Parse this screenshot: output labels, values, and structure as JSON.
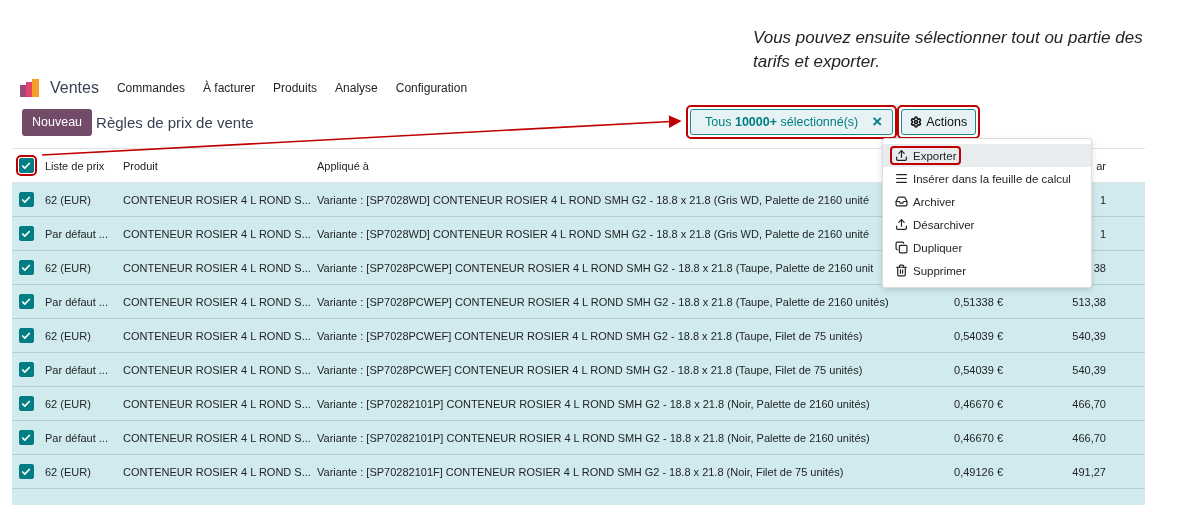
{
  "annotation": {
    "text": "Vous pouvez ensuite sélectionner tout ou partie des tarifs et exporter."
  },
  "nav": {
    "app": "Ventes",
    "menus": [
      "Commandes",
      "À facturer",
      "Produits",
      "Analyse",
      "Configuration"
    ]
  },
  "control_bar": {
    "new_button": "Nouveau",
    "title": "Règles de prix de vente"
  },
  "selection": {
    "text": "Tous **10000+** sélectionné(s)",
    "close": "×",
    "highlighted": true
  },
  "actions": {
    "label": "Actions",
    "highlighted": true,
    "menu": [
      {
        "kind": "export",
        "label": "Exporter",
        "selected": true,
        "highlighted": true
      },
      {
        "kind": "spreadsheet",
        "label": "Insérer dans la feuille de calcul",
        "selected": false,
        "highlighted": false
      },
      {
        "kind": "archive",
        "label": "Archiver",
        "selected": false,
        "highlighted": false
      },
      {
        "kind": "unarchive",
        "label": "Désarchiver",
        "selected": false,
        "highlighted": false
      },
      {
        "kind": "duplicate",
        "label": "Dupliquer",
        "selected": false,
        "highlighted": false
      },
      {
        "kind": "delete",
        "label": "Supprimer",
        "selected": false,
        "highlighted": false
      }
    ]
  },
  "table": {
    "select_all": {
      "checked": true,
      "highlighted": true
    },
    "columns": [
      {
        "label": "Liste de prix"
      },
      {
        "label": "Produit"
      },
      {
        "label": "Appliqué à"
      },
      {},
      {
        "label": "ar"
      }
    ],
    "rows": [
      {
        "checked": true,
        "pricelist": "62 (EUR)",
        "product": "CONTENEUR ROSIER 4 L ROND S...",
        "applied": "Variante : [SP7028WD] CONTENEUR ROSIER 4 L ROND SMH G2 - 18.8 x 21.8 (Gris WD, Palette de 2160 unité",
        "amount": "1"
      },
      {
        "checked": true,
        "pricelist": "Par défaut ...",
        "product": "CONTENEUR ROSIER 4 L ROND S...",
        "applied": "Variante : [SP7028WD] CONTENEUR ROSIER 4 L ROND SMH G2 - 18.8 x 21.8 (Gris WD, Palette de 2160 unité",
        "amount": "1"
      },
      {
        "checked": true,
        "pricelist": "62 (EUR)",
        "product": "CONTENEUR ROSIER 4 L ROND S...",
        "applied": "Variante : [SP7028PCWEP] CONTENEUR ROSIER 4 L ROND SMH G2 - 18.8 x 21.8 (Taupe, Palette de 2160 unit",
        "amount": "38"
      },
      {
        "checked": true,
        "pricelist": "Par défaut ...",
        "product": "CONTENEUR ROSIER 4 L ROND S...",
        "applied": "Variante : [SP7028PCWEP] CONTENEUR ROSIER 4 L ROND SMH G2 - 18.8 x 21.8 (Taupe, Palette de 2160 unités)",
        "price": "0,51338 €",
        "amount": "513,38"
      },
      {
        "checked": true,
        "pricelist": "62 (EUR)",
        "product": "CONTENEUR ROSIER 4 L ROND S...",
        "applied": "Variante : [SP7028PCWEF] CONTENEUR ROSIER 4 L ROND SMH G2 - 18.8 x 21.8 (Taupe, Filet de 75 unités)",
        "price": "0,54039 €",
        "amount": "540,39"
      },
      {
        "checked": true,
        "pricelist": "Par défaut ...",
        "product": "CONTENEUR ROSIER 4 L ROND S...",
        "applied": "Variante : [SP7028PCWEF] CONTENEUR ROSIER 4 L ROND SMH G2 - 18.8 x 21.8 (Taupe, Filet de 75 unités)",
        "price": "0,54039 €",
        "amount": "540,39"
      },
      {
        "checked": true,
        "pricelist": "62 (EUR)",
        "product": "CONTENEUR ROSIER 4 L ROND S...",
        "applied": "Variante : [SP70282101P] CONTENEUR ROSIER 4 L ROND SMH G2 - 18.8 x 21.8 (Noir, Palette de 2160 unités)",
        "price": "0,46670 €",
        "amount": "466,70"
      },
      {
        "checked": true,
        "pricelist": "Par défaut ...",
        "product": "CONTENEUR ROSIER 4 L ROND S...",
        "applied": "Variante : [SP70282101P] CONTENEUR ROSIER 4 L ROND SMH G2 - 18.8 x 21.8 (Noir, Palette de 2160 unités)",
        "price": "0,46670 €",
        "amount": "466,70"
      },
      {
        "checked": true,
        "pricelist": "62 (EUR)",
        "product": "CONTENEUR ROSIER 4 L ROND S...",
        "applied": "Variante : [SP70282101F] CONTENEUR ROSIER 4 L ROND SMH G2 - 18.8 x 21.8 (Noir, Filet de 75 unités)",
        "price": "0,49126 €",
        "amount": "491,27"
      }
    ]
  }
}
